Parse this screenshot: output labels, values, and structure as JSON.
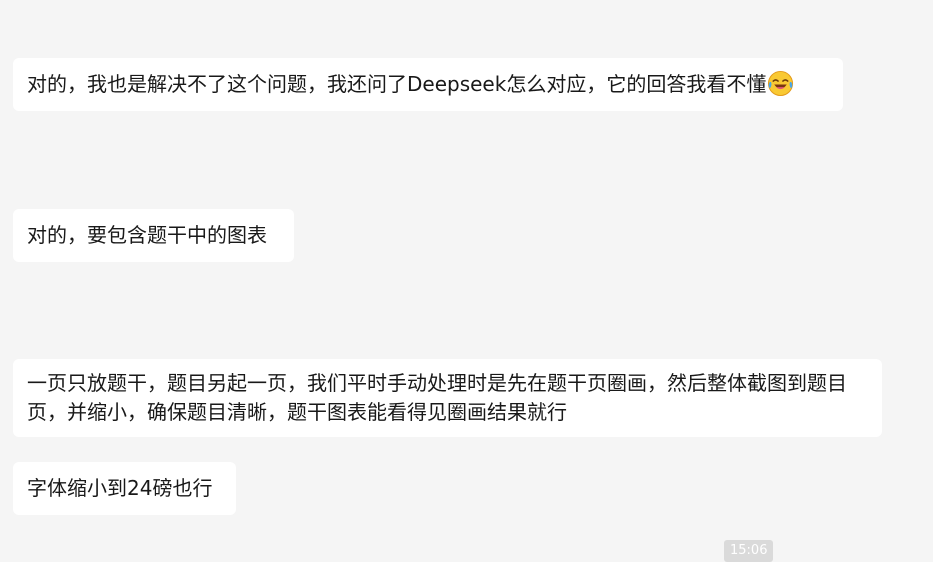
{
  "messages": [
    {
      "text": "对的，我也是解决不了这个问题，我还问了Deepseek怎么对应，它的回答我看不懂",
      "emoji": "laughing-crying-face"
    },
    {
      "text": "对的，要包含题干中的图表"
    },
    {
      "text": "一页只放题干，题目另起一页，我们平时手动处理时是先在题干页圈画，然后整体截图到题目页，并缩小，确保题目清晰，题干图表能看得见圈画结果就行"
    },
    {
      "text": "字体缩小到24磅也行"
    }
  ],
  "timestamp": "15:06",
  "colors": {
    "background": "#f5f5f5",
    "bubble": "#ffffff",
    "text": "#191919",
    "timestamp_bg": "#dadada"
  }
}
